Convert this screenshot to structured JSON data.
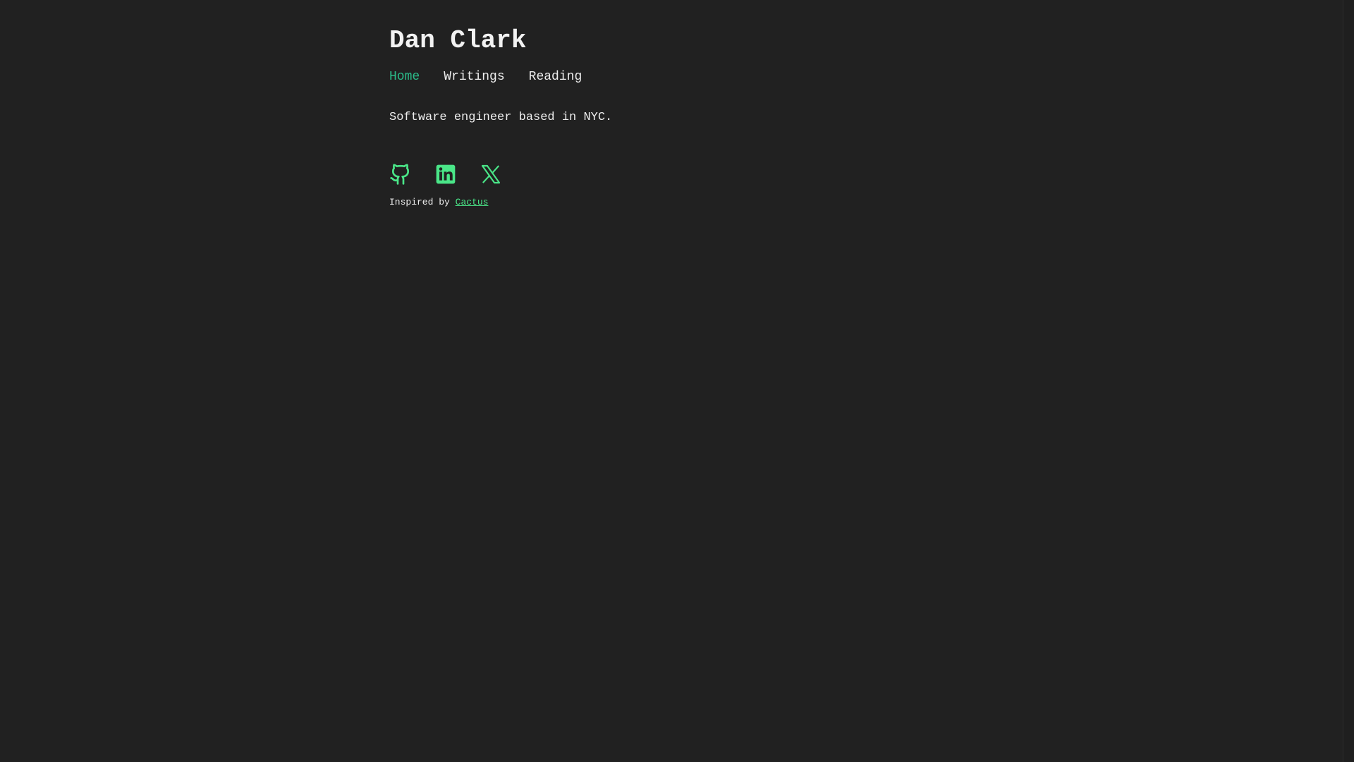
{
  "header": {
    "title": "Dan Clark"
  },
  "nav": {
    "items": [
      {
        "label": "Home",
        "active": true
      },
      {
        "label": "Writings",
        "active": false
      },
      {
        "label": "Reading",
        "active": false
      }
    ]
  },
  "main": {
    "intro": "Software engineer based in NYC."
  },
  "socials": {
    "icons": [
      "github-icon",
      "linkedin-icon",
      "x-icon"
    ],
    "color": "#4ae688"
  },
  "footer": {
    "prefix": "Inspired by",
    "link_label": "Cactus"
  },
  "theme": {
    "background": "#212121",
    "active_link": "#2bbc8a",
    "accent": "#4ae688",
    "text": "#eeeeee"
  }
}
